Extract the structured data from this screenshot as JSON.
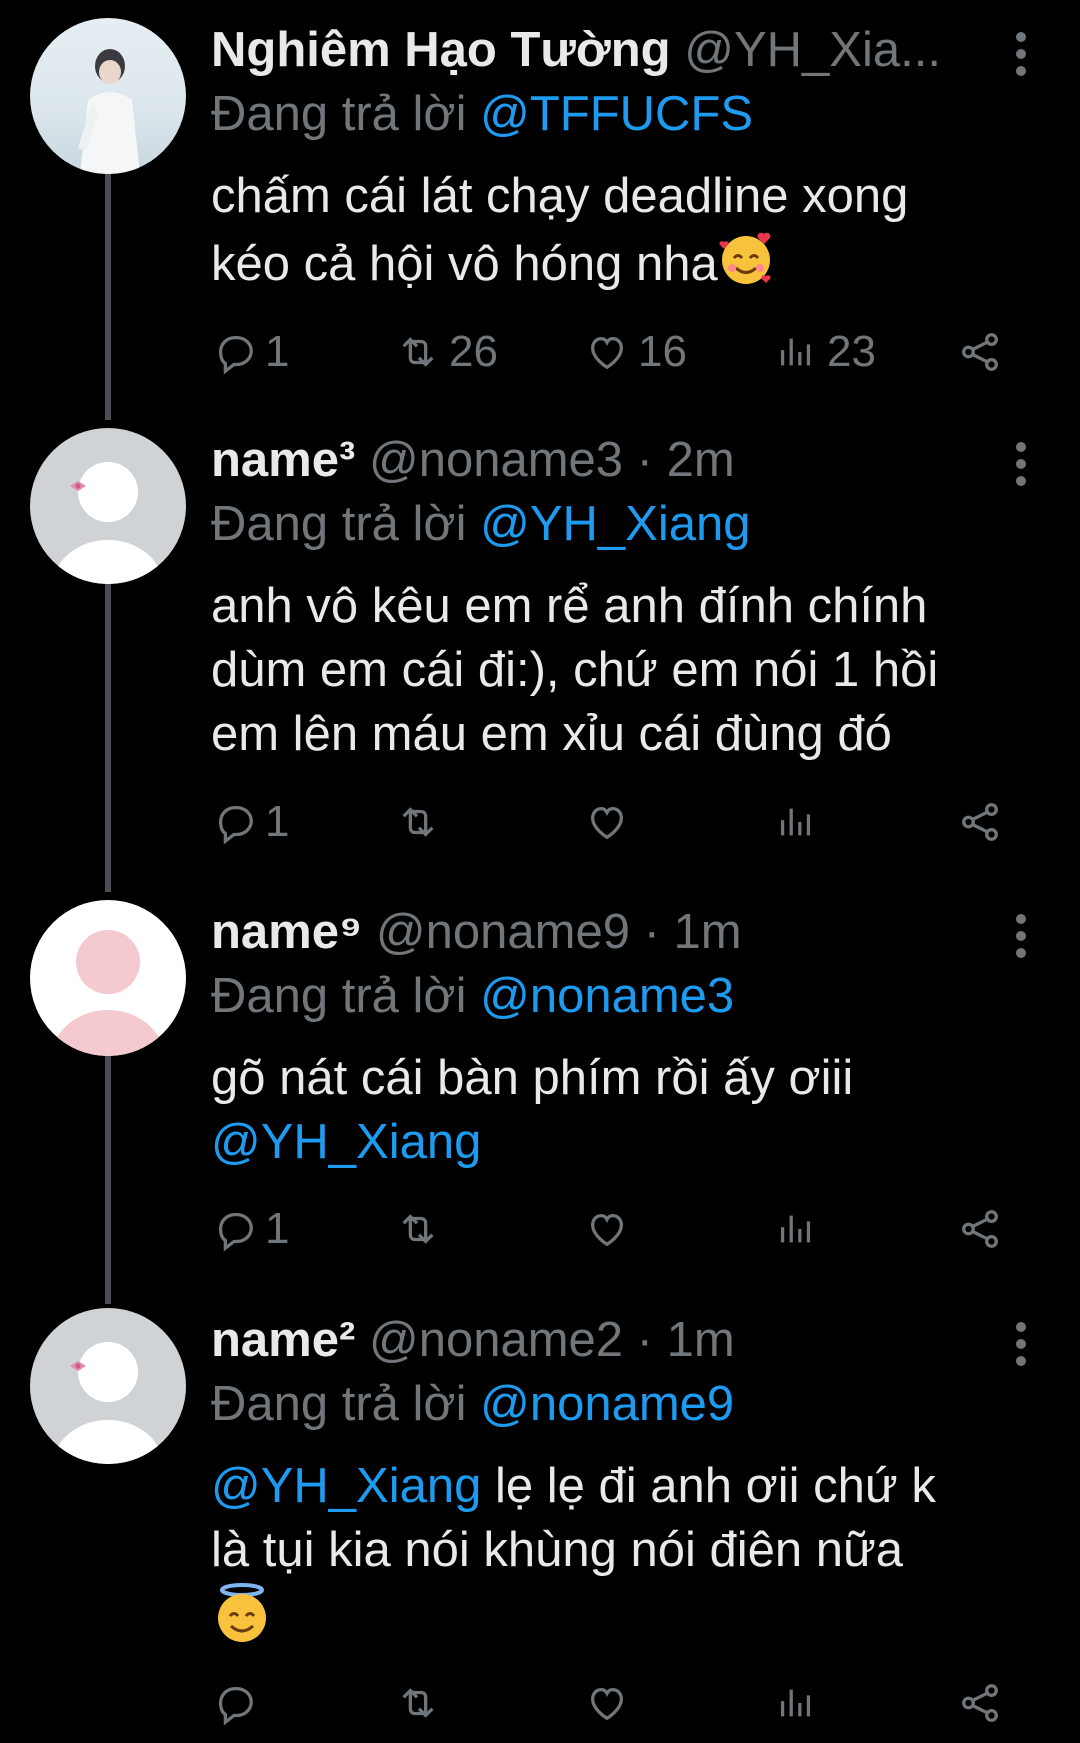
{
  "tweets": [
    {
      "name": "Nghiêm Hạo Tường",
      "handle": "@YH_Xia...",
      "time": "",
      "replying_prefix": "Đang trả lời",
      "replying_to": "@TFFUCFS",
      "body_lines": [
        "chấm cái lát chạy deadline xong",
        "kéo cả hội vô hóng nha"
      ],
      "body_emoji": "smiling-face-with-hearts",
      "counts": {
        "reply": "1",
        "retweet": "26",
        "like": "16",
        "views": "23"
      }
    },
    {
      "name": "name³",
      "handle": "@noname3",
      "time": " · 2m",
      "replying_prefix": "Đang trả lời",
      "replying_to": "@YH_Xiang",
      "body_lines": [
        "anh vô kêu em rể anh đính chính",
        "dùm em cái đi:), chứ em nói 1 hồi",
        "em lên máu em xỉu cái đùng đó"
      ],
      "counts": {
        "reply": "1",
        "retweet": "",
        "like": "",
        "views": ""
      }
    },
    {
      "name": "name⁹",
      "handle": "@noname9",
      "time": " · 1m",
      "replying_prefix": "Đang trả lời",
      "replying_to": "@noname3",
      "body_line1": "gõ nát cái bàn phím rồi ấy ơiii",
      "body_mention": "@YH_Xiang",
      "counts": {
        "reply": "1",
        "retweet": "",
        "like": "",
        "views": ""
      }
    },
    {
      "name": "name²",
      "handle": "@noname2",
      "time": " · 1m",
      "replying_prefix": "Đang trả lời",
      "replying_to": "@noname9",
      "body_mention": "@YH_Xiang",
      "body_line1_rest": " lẹ lẹ đi anh ơii chứ k",
      "body_line2": "là tụi kia nói khùng nói điên nữa",
      "body_emoji": "smiling-face-with-halo",
      "counts": {
        "reply": "",
        "retweet": "",
        "like": "",
        "views": ""
      }
    }
  ],
  "colors": {
    "background": "#000000",
    "text": "#e7e9ea",
    "secondary": "#71767b",
    "accent": "#1d9bf0"
  },
  "icons": [
    "reply-icon",
    "retweet-icon",
    "like-icon",
    "views-icon",
    "share-icon",
    "more-icon"
  ]
}
